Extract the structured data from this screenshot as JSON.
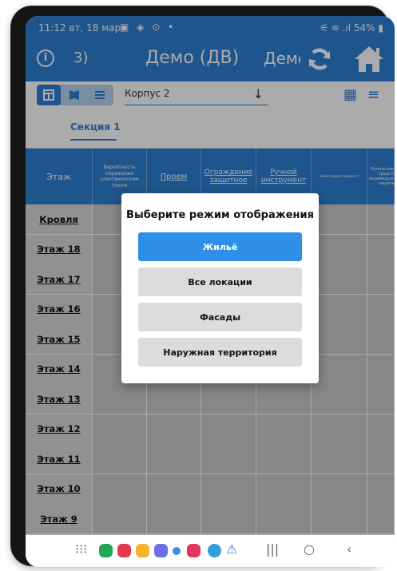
{
  "statusbar": {
    "time": "11:12",
    "date": "вт, 18 мар.",
    "right": "54%"
  },
  "appbar": {
    "info_icon": "i",
    "number": "3)",
    "title": "Демо (ДВ)",
    "title2": "Демо"
  },
  "toolbar": {
    "building": "Корпус 2"
  },
  "tabs": [
    {
      "label": "Секция 1"
    }
  ],
  "table": {
    "headers": [
      "Этаж",
      "Вероятность поражения электрическим током",
      "Проем",
      "Ограждение защитное",
      "Ручной инструмент",
      "Электроинструмент",
      "Использование средств индивидуальной защиты"
    ],
    "rows": [
      "Кровля",
      "Этаж 18",
      "Этаж 17",
      "Этаж 16",
      "Этаж 15",
      "Этаж 14",
      "Этаж 13",
      "Этаж 12",
      "Этаж 11",
      "Этаж 10",
      "Этаж 9"
    ]
  },
  "dialog": {
    "title": "Выберите режим отображения",
    "options": [
      {
        "label": "Жильё",
        "selected": true
      },
      {
        "label": "Все локации",
        "selected": false
      },
      {
        "label": "Фасады",
        "selected": false
      },
      {
        "label": "Наружная территория",
        "selected": false
      }
    ]
  },
  "colors": {
    "primary": "#2e7fd2",
    "selected_button": "#2e8fe8",
    "cell": "#c9c9c9"
  },
  "navbar_icons": [
    "apps-grid-icon",
    "recents-icon",
    "home-icon",
    "back-icon"
  ]
}
